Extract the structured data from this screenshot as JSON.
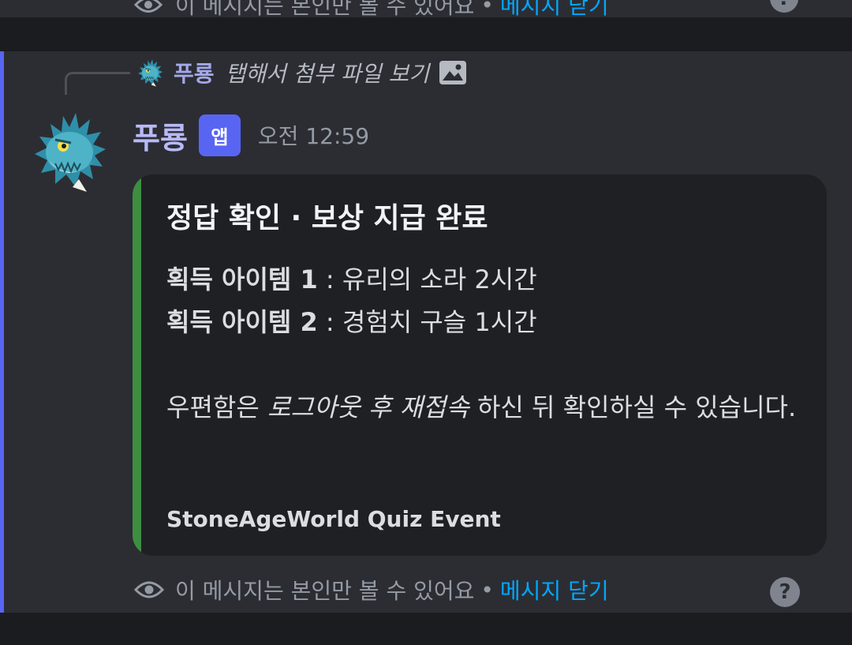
{
  "previous": {
    "ephemeral_text": "이 메시지는 본인만 볼 수 있어요",
    "separator": "•",
    "dismiss_label": "메시지 닫기",
    "help_glyph": "?"
  },
  "reply": {
    "author": "푸룡",
    "text": "탭해서 첨부 파일 보기",
    "icon": "image-icon"
  },
  "message": {
    "author": "푸룡",
    "badge": "앱",
    "timestamp": "오전 12:59",
    "avatar": "dragon-avatar"
  },
  "embed": {
    "color": "#3e8e41",
    "title": "정답 확인 · 보상 지급 완료",
    "items": [
      {
        "label": "획득 아이템 1",
        "sep": " : ",
        "value": "유리의 소라 2시간"
      },
      {
        "label": "획득 아이템 2",
        "sep": " : ",
        "value": "경험치 구슬 1시간"
      }
    ],
    "notice_prefix": "우편함은 ",
    "notice_emphasis": "로그아웃 후 재접속",
    "notice_suffix": " 하신 뒤 확인하실 수 있습니다.",
    "footer": "StoneAgeWorld Quiz Event"
  },
  "ephemeral": {
    "icon": "eye-icon",
    "text": "이 메시지는 본인만 볼 수 있어요",
    "separator": "•",
    "dismiss_label": "메시지 닫기",
    "help_glyph": "?"
  },
  "colors": {
    "accent": "#5865f2",
    "link": "#00a8fc",
    "username": "#b8b9f5"
  }
}
